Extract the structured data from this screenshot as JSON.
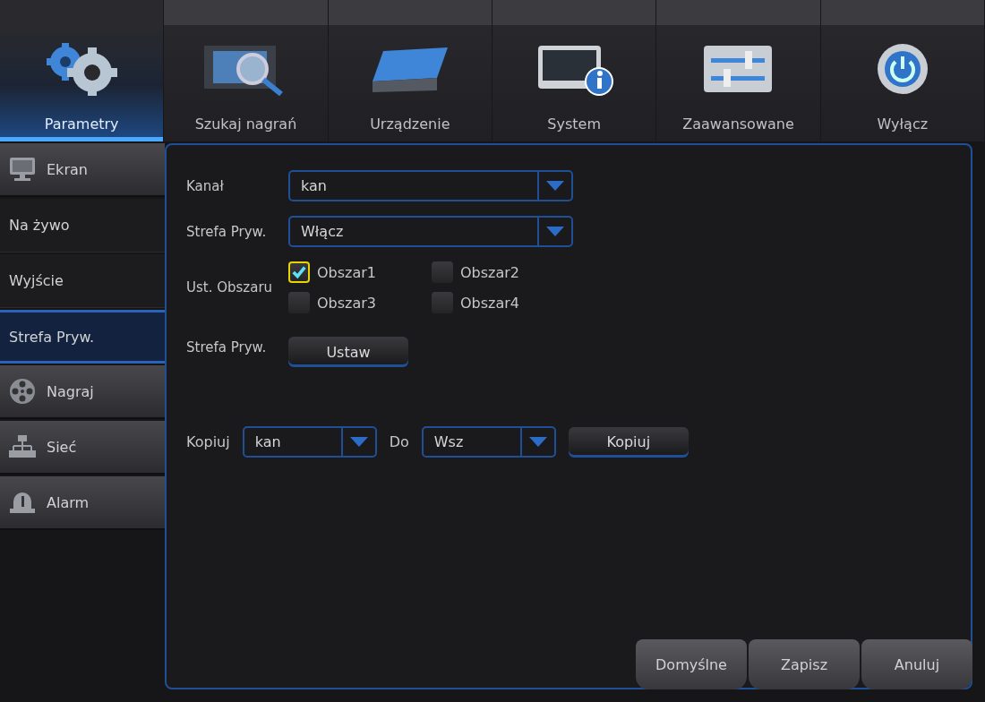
{
  "tabs": [
    {
      "label": "Parametry",
      "selected": true
    },
    {
      "label": "Szukaj nagrań",
      "selected": false
    },
    {
      "label": "Urządzenie",
      "selected": false
    },
    {
      "label": "System",
      "selected": false
    },
    {
      "label": "Zaawansowane",
      "selected": false
    },
    {
      "label": "Wyłącz",
      "selected": false
    }
  ],
  "sidebar": {
    "items": [
      {
        "label": "Ekran",
        "kind": "group",
        "selected": false
      },
      {
        "label": "Na żywo",
        "kind": "sub",
        "selected": false
      },
      {
        "label": "Wyjście",
        "kind": "sub",
        "selected": false
      },
      {
        "label": "Strefa Pryw.",
        "kind": "sub",
        "selected": true
      },
      {
        "label": "Nagraj",
        "kind": "group",
        "selected": false
      },
      {
        "label": "Sieć",
        "kind": "group",
        "selected": false
      },
      {
        "label": "Alarm",
        "kind": "group",
        "selected": false
      }
    ]
  },
  "form": {
    "channel": {
      "label": "Kanał",
      "value": "kan"
    },
    "privacy": {
      "label": "Strefa Pryw.",
      "value": "Włącz"
    },
    "areas": {
      "label": "Ust. Obszaru",
      "items": [
        {
          "label": "Obszar1",
          "checked": true,
          "focused": true
        },
        {
          "label": "Obszar2",
          "checked": false,
          "focused": false
        },
        {
          "label": "Obszar3",
          "checked": false,
          "focused": false
        },
        {
          "label": "Obszar4",
          "checked": false,
          "focused": false
        }
      ]
    },
    "setup": {
      "label": "Strefa Pryw.",
      "button": "Ustaw"
    },
    "copy": {
      "label": "Kopiuj",
      "from": "kan",
      "to_label": "Do",
      "to": "Wsz",
      "button": "Kopiuj"
    }
  },
  "buttons": [
    "Domyślne",
    "Zapisz",
    "Anuluj"
  ]
}
